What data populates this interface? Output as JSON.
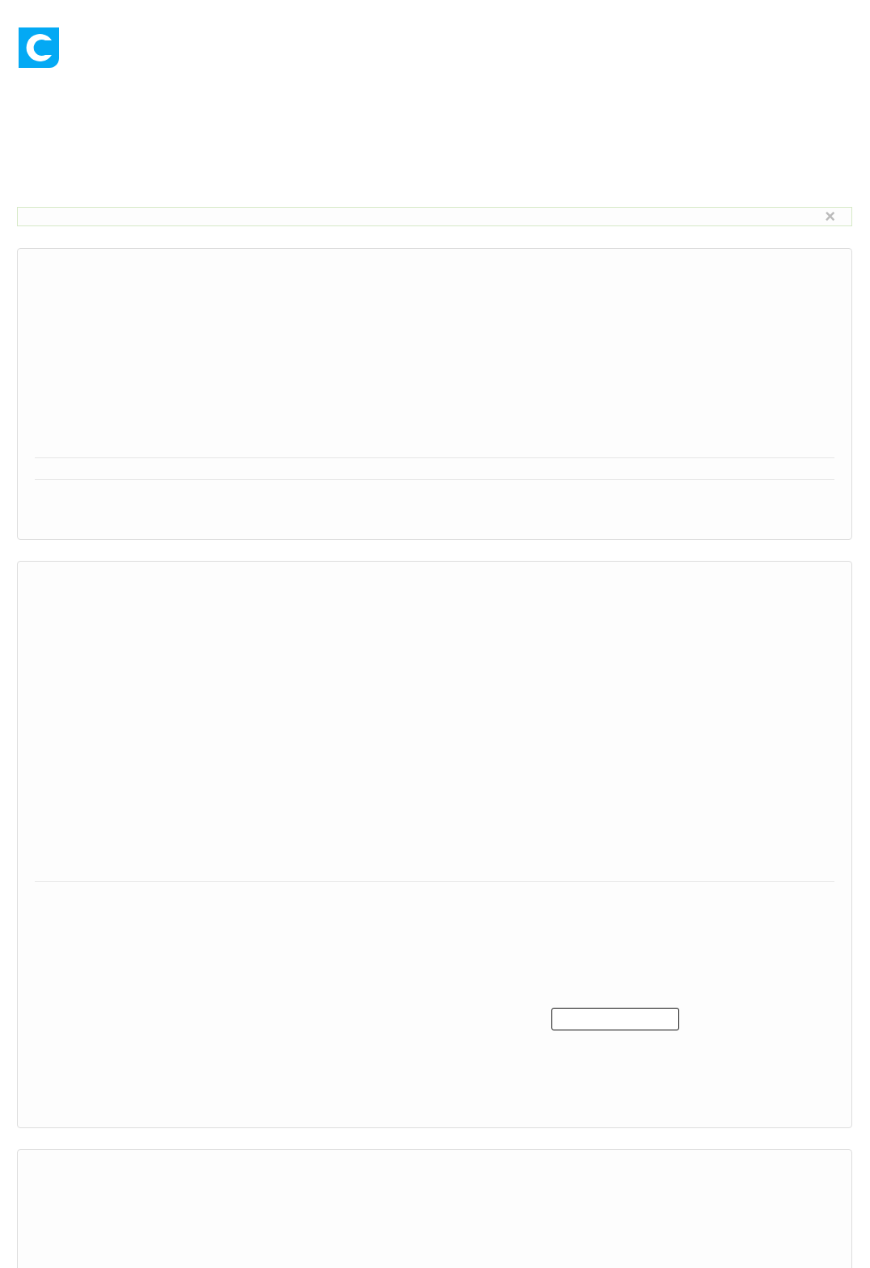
{
  "alert": {
    "close": "×"
  }
}
